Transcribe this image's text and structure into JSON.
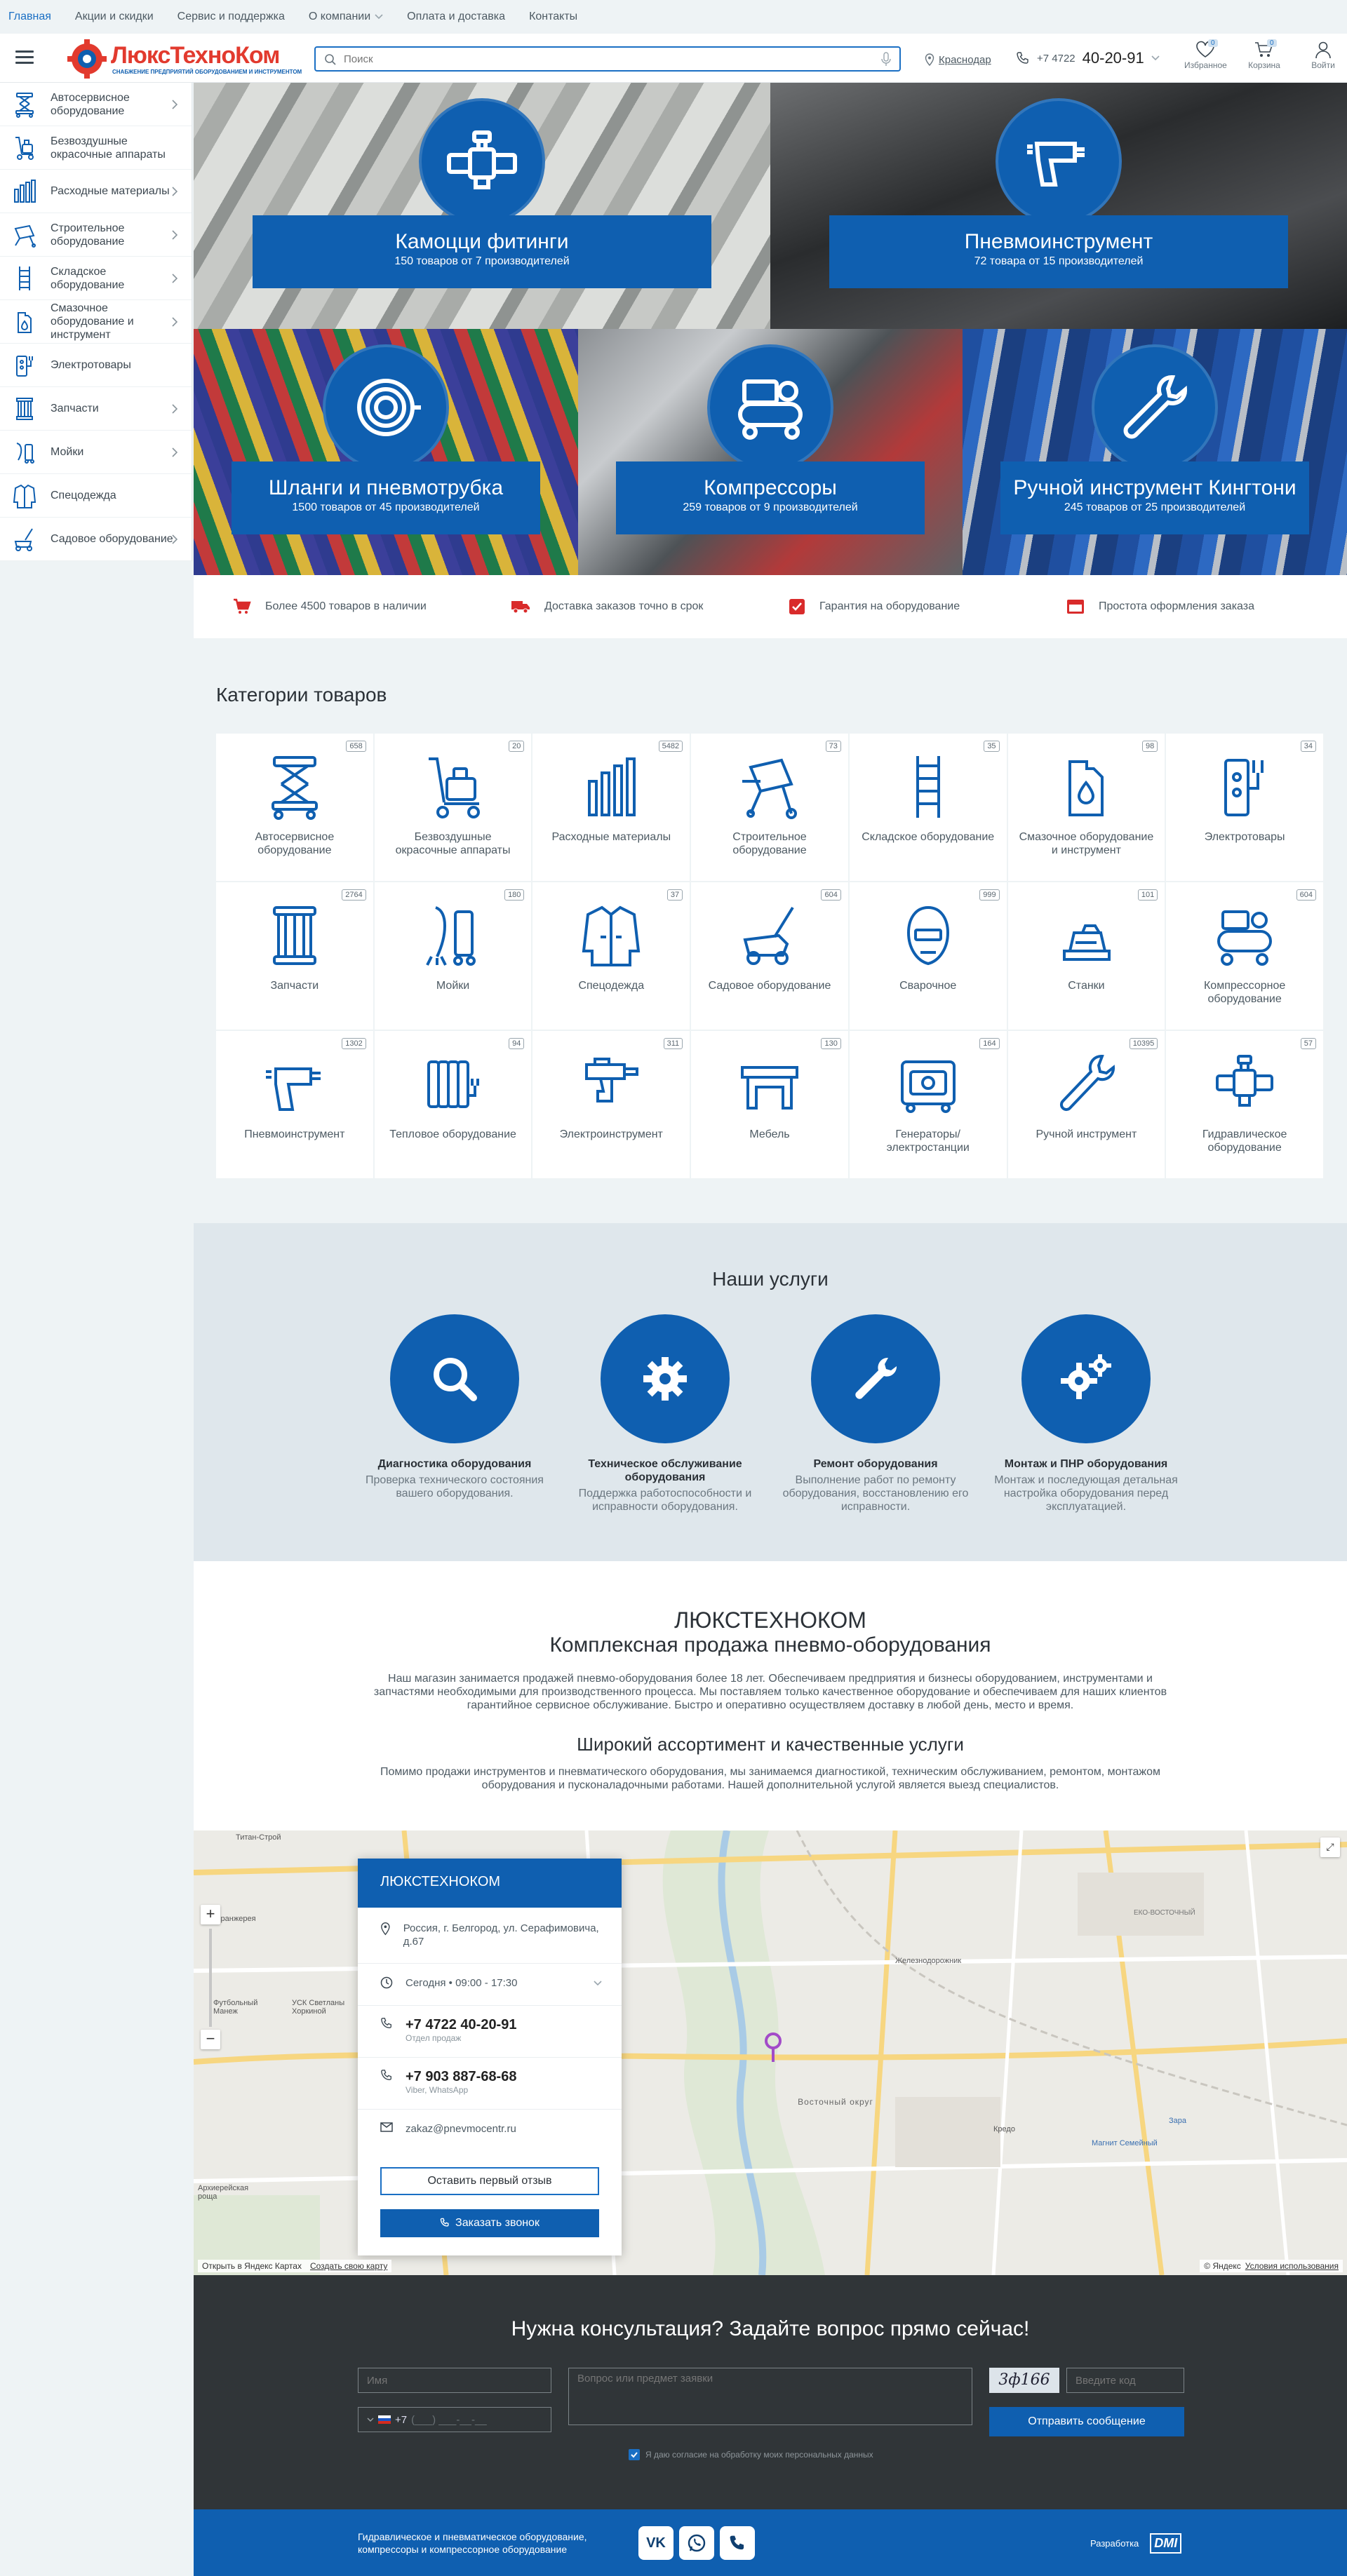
{
  "topnav": [
    "Главная",
    "Акции и скидки",
    "Сервис и поддержка",
    "О компании",
    "Оплата и доставка",
    "Контакты"
  ],
  "logo": {
    "name": "ЛюксТехноКом",
    "tagline": "СНАБЖЕНИЕ ПРЕДПРИЯТИЙ ОБОРУДОВАНИЕМ И ИНСТРУМЕНТОМ"
  },
  "search": {
    "placeholder": "Поиск"
  },
  "city": "Краснодар",
  "phone": {
    "code": "+7 4722",
    "number": "40-20-91"
  },
  "header_icons": [
    {
      "label": "Избранное",
      "badge": "0"
    },
    {
      "label": "Корзина",
      "badge": "0"
    },
    {
      "label": "Войти",
      "badge": ""
    }
  ],
  "sidebar": [
    {
      "label": "Автосервисное оборудование",
      "chev": true
    },
    {
      "label": "Безвоздушные окрасочные аппараты",
      "chev": false
    },
    {
      "label": "Расходные материалы",
      "chev": true
    },
    {
      "label": "Строительное оборудование",
      "chev": true
    },
    {
      "label": "Складское оборудование",
      "chev": true
    },
    {
      "label": "Смазочное оборудование и инструмент",
      "chev": true
    },
    {
      "label": "Электротовары",
      "chev": false
    },
    {
      "label": "Запчасти",
      "chev": true
    },
    {
      "label": "Мойки",
      "chev": true
    },
    {
      "label": "Спецодежда",
      "chev": false
    },
    {
      "label": "Садовое оборудование",
      "chev": true
    }
  ],
  "hero": [
    {
      "title": "Камоцци фитинги",
      "sub": "150 товаров от 7 производителей"
    },
    {
      "title": "Пневмоинструмент",
      "sub": "72 товара от 15 производителей"
    },
    {
      "title": "Шланги и пневмотрубка",
      "sub": "1500 товаров от 45 производителей"
    },
    {
      "title": "Компрессоры",
      "sub": "259 товаров от 9 производителей"
    },
    {
      "title": "Ручной инструмент Кингтони",
      "sub": "245 товаров от 25 производителей"
    }
  ],
  "features": [
    "Более 4500 товаров в наличии",
    "Доставка заказов точно в срок",
    "Гарантия на оборудование",
    "Простота оформления заказа"
  ],
  "categories_title": "Категории товаров",
  "categories": [
    {
      "name": "Автосервисное оборудование",
      "count": "658"
    },
    {
      "name": "Безвоздушные окрасочные аппараты",
      "count": "20"
    },
    {
      "name": "Расходные материалы",
      "count": "5482"
    },
    {
      "name": "Строительное оборудование",
      "count": "73"
    },
    {
      "name": "Складское оборудование",
      "count": "35"
    },
    {
      "name": "Смазочное оборудование и инструмент",
      "count": "98"
    },
    {
      "name": "Электротовары",
      "count": "34"
    },
    {
      "name": "Запчасти",
      "count": "2764"
    },
    {
      "name": "Мойки",
      "count": "180"
    },
    {
      "name": "Спецодежда",
      "count": "37"
    },
    {
      "name": "Садовое оборудование",
      "count": "604"
    },
    {
      "name": "Сварочное",
      "count": "999"
    },
    {
      "name": "Станки",
      "count": "101"
    },
    {
      "name": "Компрессорное оборудование",
      "count": "604"
    },
    {
      "name": "Пневмоинструмент",
      "count": "1302"
    },
    {
      "name": "Тепловое оборудование",
      "count": "94"
    },
    {
      "name": "Электроинструмент",
      "count": "311"
    },
    {
      "name": "Мебель",
      "count": "130"
    },
    {
      "name": "Генераторы/ электростанции",
      "count": "164"
    },
    {
      "name": "Ручной инструмент",
      "count": "10395"
    },
    {
      "name": "Гидравлическое оборудование",
      "count": "57"
    }
  ],
  "services_title": "Наши услуги",
  "services": [
    {
      "title": "Диагностика оборудования",
      "desc": "Проверка технического состояния вашего оборудования."
    },
    {
      "title": "Техническое обслуживание оборудования",
      "desc": "Поддержка работоспособности и исправности оборудования."
    },
    {
      "title": "Ремонт оборудования",
      "desc": "Выполнение работ по ремонту оборудования, восстановлению его исправности."
    },
    {
      "title": "Монтаж и ПНР оборудования",
      "desc": "Монтаж и последующая детальная настройка оборудования перед эксплуатацией."
    }
  ],
  "about": {
    "title1": "ЛЮКСТЕХНОКОМ",
    "title2": "Комплексная продажа пневмо-оборудования",
    "p1": "Наш магазин занимается продажей пневмо-оборудования более 18 лет. Обеспечиваем предприятия и бизнесы оборудованием, инструментами и запчастями необходимыми для производственного процесса. Мы поставляем только качественное оборудование и обеспечиваем для наших клиентов гарантийное сервисное обслуживание. Быстро и оперативно осуществляем доставку в любой день, место и время.",
    "subtitle": "Широкий ассортимент и качественные услуги",
    "p2": "Помимо продажи инструментов и пневматического оборудования, мы занимаемся диагностикой, техническим обслуживанием, ремонтом, монтажом оборудования и пусконаладочными работами. Нашей дополнительной услугой является выезд специалистов."
  },
  "contact": {
    "title": "ЛЮКСТЕХНОКОМ",
    "address": "Россия, г. Белгород, ул. Серафимовича, д.67",
    "hours": "Сегодня • 09:00 - 17:30",
    "phone1": "+7 4722 40-20-91",
    "phone1_sub": "Отдел продаж",
    "phone2": "+7 903 887-68-68",
    "phone2_sub": "Viber, WhatsApp",
    "email": "zakaz@pnevmocentr.ru",
    "btn_review": "Оставить первый отзыв",
    "btn_call": "Заказать звонок"
  },
  "map": {
    "open": "Открыть в Яндекс Картах",
    "create": "Создать свою карту",
    "copyright": "© Яндекс",
    "terms": "Условия использования",
    "labels": [
      "Титан-Строй",
      "Оранжерея",
      "Футбольный Манеж",
      "УСК Светланы Хоркиной",
      "Восточный округ",
      "Железнодорожник",
      "Кредо",
      "Магнит Семейный",
      "Зара",
      "Архиерейская роща",
      "ЕКО-ВОСТОЧНЫЙ"
    ]
  },
  "consult": {
    "title": "Нужна консультация? Задайте вопрос прямо сейчас!",
    "name_ph": "Имя",
    "phone_prefix": "+7",
    "phone_mask": "(___) ___-__-__",
    "question_ph": "Вопрос или предмет заявки",
    "captcha": "3ф166",
    "code_ph": "Введите код",
    "send": "Отправить сообщение",
    "consent": "Я даю согласие на обработку моих персональных данных"
  },
  "footer": {
    "text": "Гидравлическое и пневматическое оборудование, компрессоры и компрессорное оборудование",
    "dev": "Разработка",
    "dev_logo": "DMI"
  },
  "colors": {
    "brand": "#0f5fb0",
    "link": "#1a6fc4",
    "bg": "#eef3f5",
    "dark": "#303538"
  }
}
